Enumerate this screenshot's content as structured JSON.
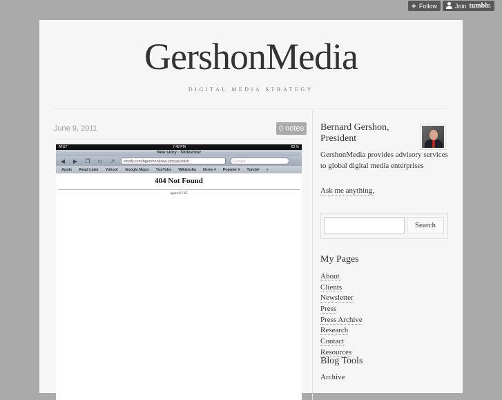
{
  "tumblr_controls": {
    "follow_label": "Follow",
    "join_label": "Join",
    "join_brand": "tumblr."
  },
  "blog": {
    "title": "GershonMedia",
    "tagline": "DIGITAL MEDIA STRATEGY"
  },
  "post": {
    "date": "June 9, 2011",
    "notes": "0 notes",
    "image": {
      "status_carrier": "AT&T",
      "status_time": "7:48 PM",
      "status_battery": "63 %",
      "page_title": "New story - Slideshow",
      "url": "storify.com/bgershon/new-story/publish",
      "search_placeholder": "Google",
      "bookmarks": [
        "Apple",
        "Read Later",
        "Yahoo!",
        "Google Maps",
        "YouTube",
        "Wikipedia",
        "News ▾",
        "Popular ▾",
        "Tumblr"
      ],
      "error_title": "404 Not Found",
      "server": "nginx/0.7.65"
    }
  },
  "sidebar": {
    "author_name": "Bernard Gershon, President",
    "description": "GershonMedia provides advisory services to global digital media enterprises",
    "ask_link": "Ask me anything,",
    "search_button": "Search",
    "my_pages_heading": "My Pages",
    "pages": [
      "About",
      "Clients",
      "Newsletter",
      "Press",
      "Press Archive",
      "Research",
      "Contact",
      "Resources"
    ],
    "blog_tools_heading": "Blog Tools",
    "archive_link": "Archive"
  }
}
